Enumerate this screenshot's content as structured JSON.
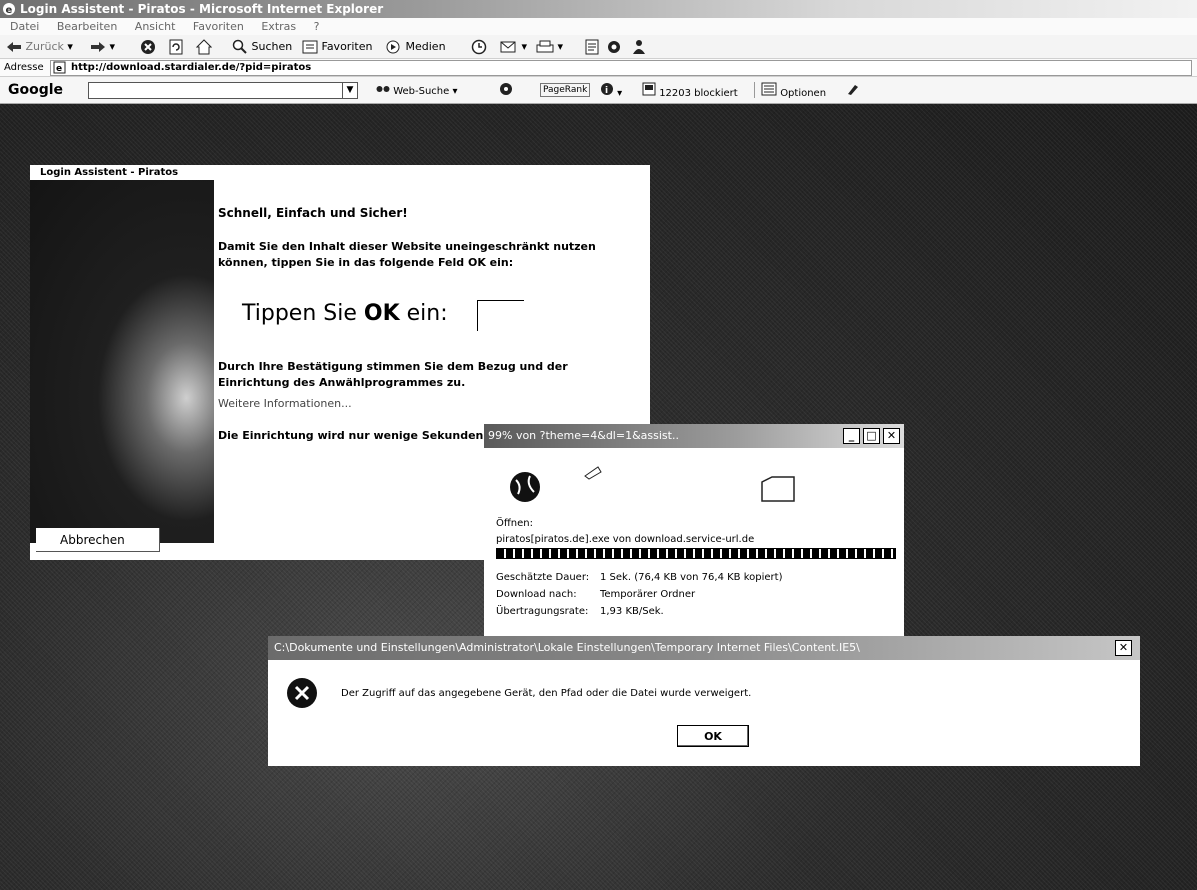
{
  "window": {
    "title": "Login Assistent - Piratos - Microsoft Internet Explorer"
  },
  "menubar": [
    "Datei",
    "Bearbeiten",
    "Ansicht",
    "Favoriten",
    "Extras",
    "?"
  ],
  "toolbar": {
    "back_label": "Zurück",
    "search_label": "Suchen",
    "favorites_label": "Favoriten",
    "media_label": "Medien"
  },
  "address": {
    "label": "Adresse",
    "url": "http://download.stardialer.de/?pid=piratos"
  },
  "googlebar": {
    "logo": "Google",
    "web_search_label": "Web-Suche",
    "pagerank_label": "PageRank",
    "popup_blocked_label": "12203 blockiert",
    "options_label": "Optionen"
  },
  "login_panel": {
    "title": "Login Assistent - Piratos",
    "heading": "Schnell, Einfach und Sicher!",
    "intro": "Damit Sie den Inhalt dieser Website uneingeschränkt nutzen können, tippen Sie in das folgende Feld OK ein:",
    "prompt_prefix": "Tippen Sie",
    "prompt_ok": "OK",
    "prompt_suffix": "ein:",
    "consent": "Durch Ihre Bestätigung stimmen Sie dem Bezug und der Einrichtung des Anwählprogrammes zu.",
    "more_info": "Weitere Informationen...",
    "setup_note": "Die Einrichtung wird nur wenige Sekunden",
    "cancel_label": "Abbrechen"
  },
  "download_dialog": {
    "title": "99% von ?theme=4&dl=1&assist..",
    "progress_percent": 99,
    "open_label": "Öffnen:",
    "filename": "piratos[piratos.de].exe von download.service-url.de",
    "rows": [
      {
        "label": "Geschätzte Dauer:",
        "value": "1 Sek. (76,4 KB von 76,4 KB kopiert)"
      },
      {
        "label": "Download nach:",
        "value": "Temporärer Ordner"
      },
      {
        "label": "Übertragungsrate:",
        "value": "1,93 KB/Sek."
      }
    ]
  },
  "error_dialog": {
    "title": "C:\\Dokumente und Einstellungen\\Administrator\\Lokale Einstellungen\\Temporary Internet Files\\Content.IE5\\",
    "message": "Der Zugriff auf das angegebene Gerät, den Pfad oder die Datei wurde verweigert.",
    "ok_label": "OK"
  },
  "colors": {
    "page_background": "#2a2a2a",
    "dialog_background": "#ffffff"
  }
}
